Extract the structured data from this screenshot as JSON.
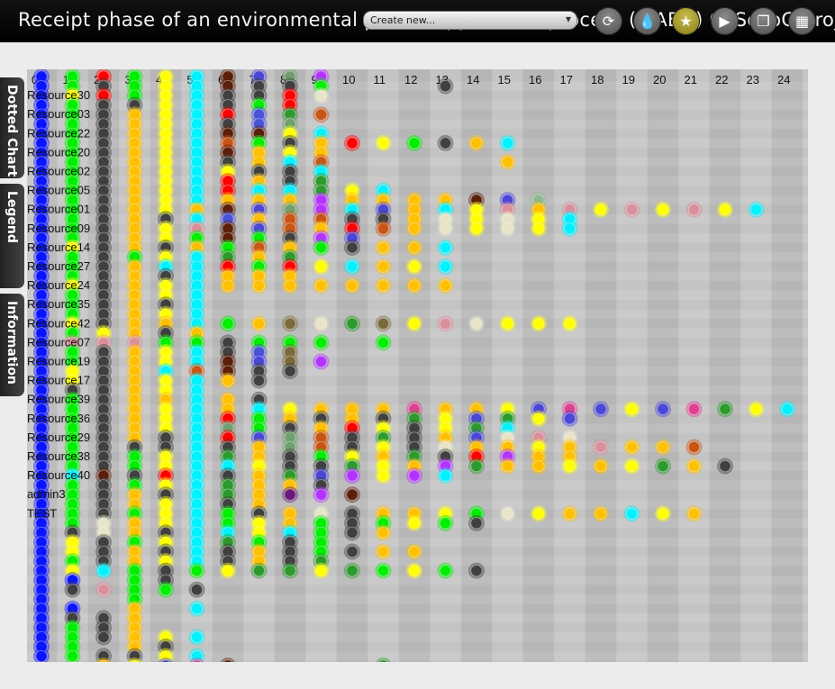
{
  "header": {
    "title": "Receipt phase of an environmental permit application process (WABO) CoSeLoG project",
    "create_new_label": "Create new...",
    "toolbar_icons": [
      "refresh-icon",
      "drop-icon",
      "star-icon",
      "play-icon",
      "copy-icon",
      "grid-icon"
    ]
  },
  "side_tabs": [
    "Dotted Chart",
    "Legend",
    "Information"
  ],
  "palette": {
    "B": "#0a14ff",
    "G": "#00ee00",
    "K": "#404040",
    "Y": "#ffff00",
    "O": "#ffc000",
    "C": "#00f2ff",
    "R": "#ff0000",
    "M": "#5c1f0a",
    "P": "#b333ff",
    "N": "#4b47d6",
    "D": "#2c9a2c",
    "E": "#e8e4c8",
    "A": "#da8f9c",
    "F": "#c95514",
    "Q": "#ff88bb",
    "S": "#e04090",
    "H": "#7a6a3a",
    "L": "#70a070",
    "T": "#6a1a7a",
    "I": "#4a52d8",
    "U": "#8fb88f"
  },
  "chart_data": {
    "type": "scatter",
    "x_ticks": [
      "0",
      "1",
      "2",
      "3",
      "4",
      "5",
      "6",
      "7",
      "8",
      "9",
      "10",
      "11",
      "12",
      "13",
      "14",
      "15",
      "16",
      "17",
      "18",
      "19",
      "20",
      "21",
      "22",
      "23",
      "24"
    ],
    "y_labels": [
      {
        "row": 2,
        "text": "Resource30"
      },
      {
        "row": 4,
        "text": "Resource03"
      },
      {
        "row": 6,
        "text": "Resource22"
      },
      {
        "row": 8,
        "text": "Resource20"
      },
      {
        "row": 10,
        "text": "Resource02"
      },
      {
        "row": 12,
        "text": "Resource05"
      },
      {
        "row": 14,
        "text": "Resource01"
      },
      {
        "row": 16,
        "text": "Resource09"
      },
      {
        "row": 18,
        "text": "Resource14"
      },
      {
        "row": 20,
        "text": "Resource27"
      },
      {
        "row": 22,
        "text": "Resource24"
      },
      {
        "row": 24,
        "text": "Resource35"
      },
      {
        "row": 26,
        "text": "Resource42"
      },
      {
        "row": 28,
        "text": "Resource07"
      },
      {
        "row": 30,
        "text": "Resource19"
      },
      {
        "row": 32,
        "text": "Resource17"
      },
      {
        "row": 34,
        "text": "Resource39"
      },
      {
        "row": 36,
        "text": "Resource36"
      },
      {
        "row": 38,
        "text": "Resource29"
      },
      {
        "row": 40,
        "text": "Resource38"
      },
      {
        "row": 42,
        "text": "Resource40"
      },
      {
        "row": 44,
        "text": "admin3"
      },
      {
        "row": 46,
        "text": "TEST"
      }
    ],
    "rows": [
      "BGRGYCMNLP",
      "BGKGYCMKKG...K",
      "BYRGYCKKRE",
      "BGKKYCKGR",
      "BGKOYCRIDF",
      "BGKOYCKIL",
      "BGKOYCMMYC",
      "BGKOYCFGKORYGKOC",
      "BGKOYCMOYO",
      "BGKOYCKOCF.....O",
      "BGKOYCYKKC",
      "BGKOYCROKD",
      "BGKOYCRCCDYC",
      "BGKOYCOOOPOOOOMNU",
      "BGKOYOMNLPCNOCYAOAYAYAYC",
      "BGKOKCIOFFKKOEYEYC",
      "BGKOYAMNFORFOEYEYC",
      "BGKOYGMGKPN",
      "BYKOKOGFOGKOOC",
      "BGKGYCDOD",
      "BGKOCCRGRYCOYC",
      "BGKOKCOOO",
      "BYKOYCOOOOOOOO",
      "BGKOYC",
      "BGKOKC",
      "BGKOYC",
      "BYKOOCGOHEDHYAEYYY",
      "BGYOKO",
      "BAAAGGKGGG.G",
      "BGKOYCKIH.",
      "BGKOYCMNHP",
      "BYKOCFMKK",
      "BYKOYCOK",
      "BKKOYC",
      "BGKOOCOK",
      "BGKOYCOCYOOOSOOYNSNYNSDYC",
      "BGKOYCRGOKOKDYNDYN",
      "BGKOYCLGKORYKYDC",
      "BGKOKCRNLFKDKONEAE",
      "BGKKKCKOLFKYKEOOYOAOOF",
      "BGKGYCDOKGYODKRPOO",
      "BGKGYCCYKKDYOPDOOYOYDOK",
      "BCMKRCKODNPYPC",
      "BGKGYCDOOK",
      "BGKOKCDOTPM",
      "BGKOYCKO",
      "BGKGYCGKOEKOOYGEYOOCYO",
      "BGEOYCGYOGKGYGK",
      "BKEOKCCYCGKO",
      "BYKGYCDGKG",
      "BYKOKCKOKGKOO",
      "BGKOYCKOKD",
      "BYCGKGYDDYDGYGK",
      "BB.GK",
      "BKAGGK",
      "B..G",
      "BB.O.C",
      "BKKO",
      "BGKO",
      "BGKOYC",
      "BG.OK",
      "BGKKYC",
      "..OYNSM....D"
    ]
  }
}
